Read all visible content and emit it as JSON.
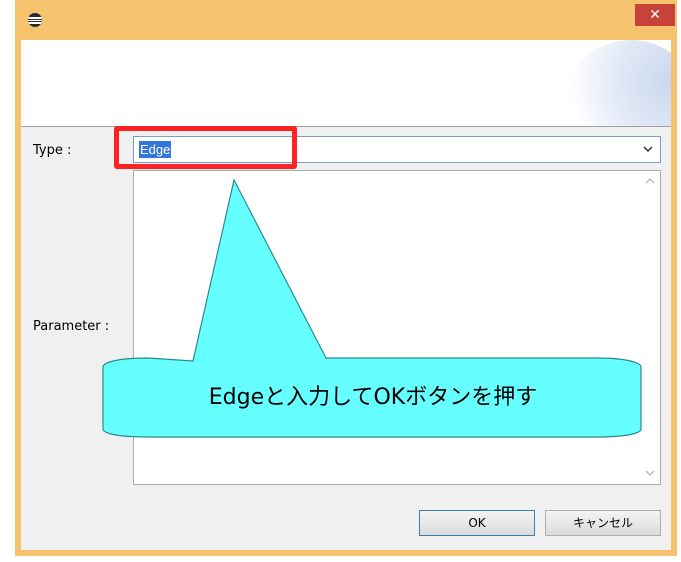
{
  "window": {
    "close_label": "✕",
    "colors": {
      "frame": "#f5c36e",
      "close": "#c7423a",
      "client": "#f0f0f0"
    }
  },
  "form": {
    "type_label": "Type :",
    "type_value": "Edge",
    "parameter_label": "Parameter :"
  },
  "buttons": {
    "ok_label": "OK",
    "cancel_label": "キャンセル"
  },
  "annotation": {
    "callout_text": "Edgeと入力してOKボタンを押す",
    "callout_color": "#66ffff",
    "highlight_color": "#ff2222"
  },
  "icons": {
    "app": "eclipse-icon",
    "dropdown": "chevron-down-icon",
    "scroll_up": "chevron-up-icon",
    "scroll_down": "chevron-down-icon"
  }
}
